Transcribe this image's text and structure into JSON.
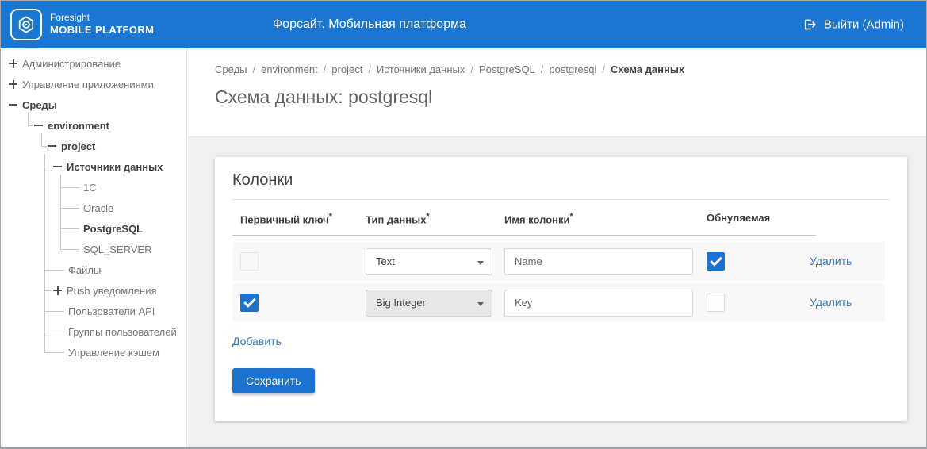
{
  "colors": {
    "accent": "#1a73d2",
    "link": "#3779c0",
    "header_bg": "#1976d2",
    "content_bg": "#f0f0f1"
  },
  "header": {
    "logo_line1": "Foresight",
    "logo_line2": "MOBILE PLATFORM",
    "title": "Форсайт. Мобильная платформа",
    "logout_label": "Выйти (Admin)"
  },
  "sidebar": {
    "items": [
      {
        "label": "Администрирование"
      },
      {
        "label": "Управление приложениями"
      },
      {
        "label": "Среды"
      },
      {
        "label": "environment"
      },
      {
        "label": "project"
      },
      {
        "label": "Источники данных"
      },
      {
        "label": "1C"
      },
      {
        "label": "Oracle"
      },
      {
        "label": "PostgreSQL"
      },
      {
        "label": "SQL_SERVER"
      },
      {
        "label": "Файлы"
      },
      {
        "label": "Push уведомления"
      },
      {
        "label": "Пользователи API"
      },
      {
        "label": "Группы пользователей"
      },
      {
        "label": "Управление кэшем"
      }
    ]
  },
  "breadcrumb": {
    "separator": "/",
    "items": [
      "Среды",
      "environment",
      "project",
      "Источники данных",
      "PostgreSQL",
      "postgresql",
      "Схема данных"
    ]
  },
  "page": {
    "title": "Схема данных: postgresql"
  },
  "card": {
    "title": "Колонки",
    "add_label": "Добавить",
    "save_label": "Сохранить",
    "table": {
      "required_mark": "*",
      "headers": [
        {
          "label": "Первичный ключ"
        },
        {
          "label": "Тип данных"
        },
        {
          "label": "Имя колонки"
        },
        {
          "label": "Обнуляемая"
        }
      ],
      "rows": [
        {
          "primary_key": false,
          "primary_key_disabled": true,
          "data_type": "Text",
          "data_type_disabled": false,
          "column_name": "Name",
          "nullable": true,
          "delete_label": "Удалить"
        },
        {
          "primary_key": true,
          "primary_key_disabled": false,
          "data_type": "Big Integer",
          "data_type_disabled": true,
          "column_name": "Key",
          "nullable": false,
          "delete_label": "Удалить"
        }
      ]
    }
  }
}
